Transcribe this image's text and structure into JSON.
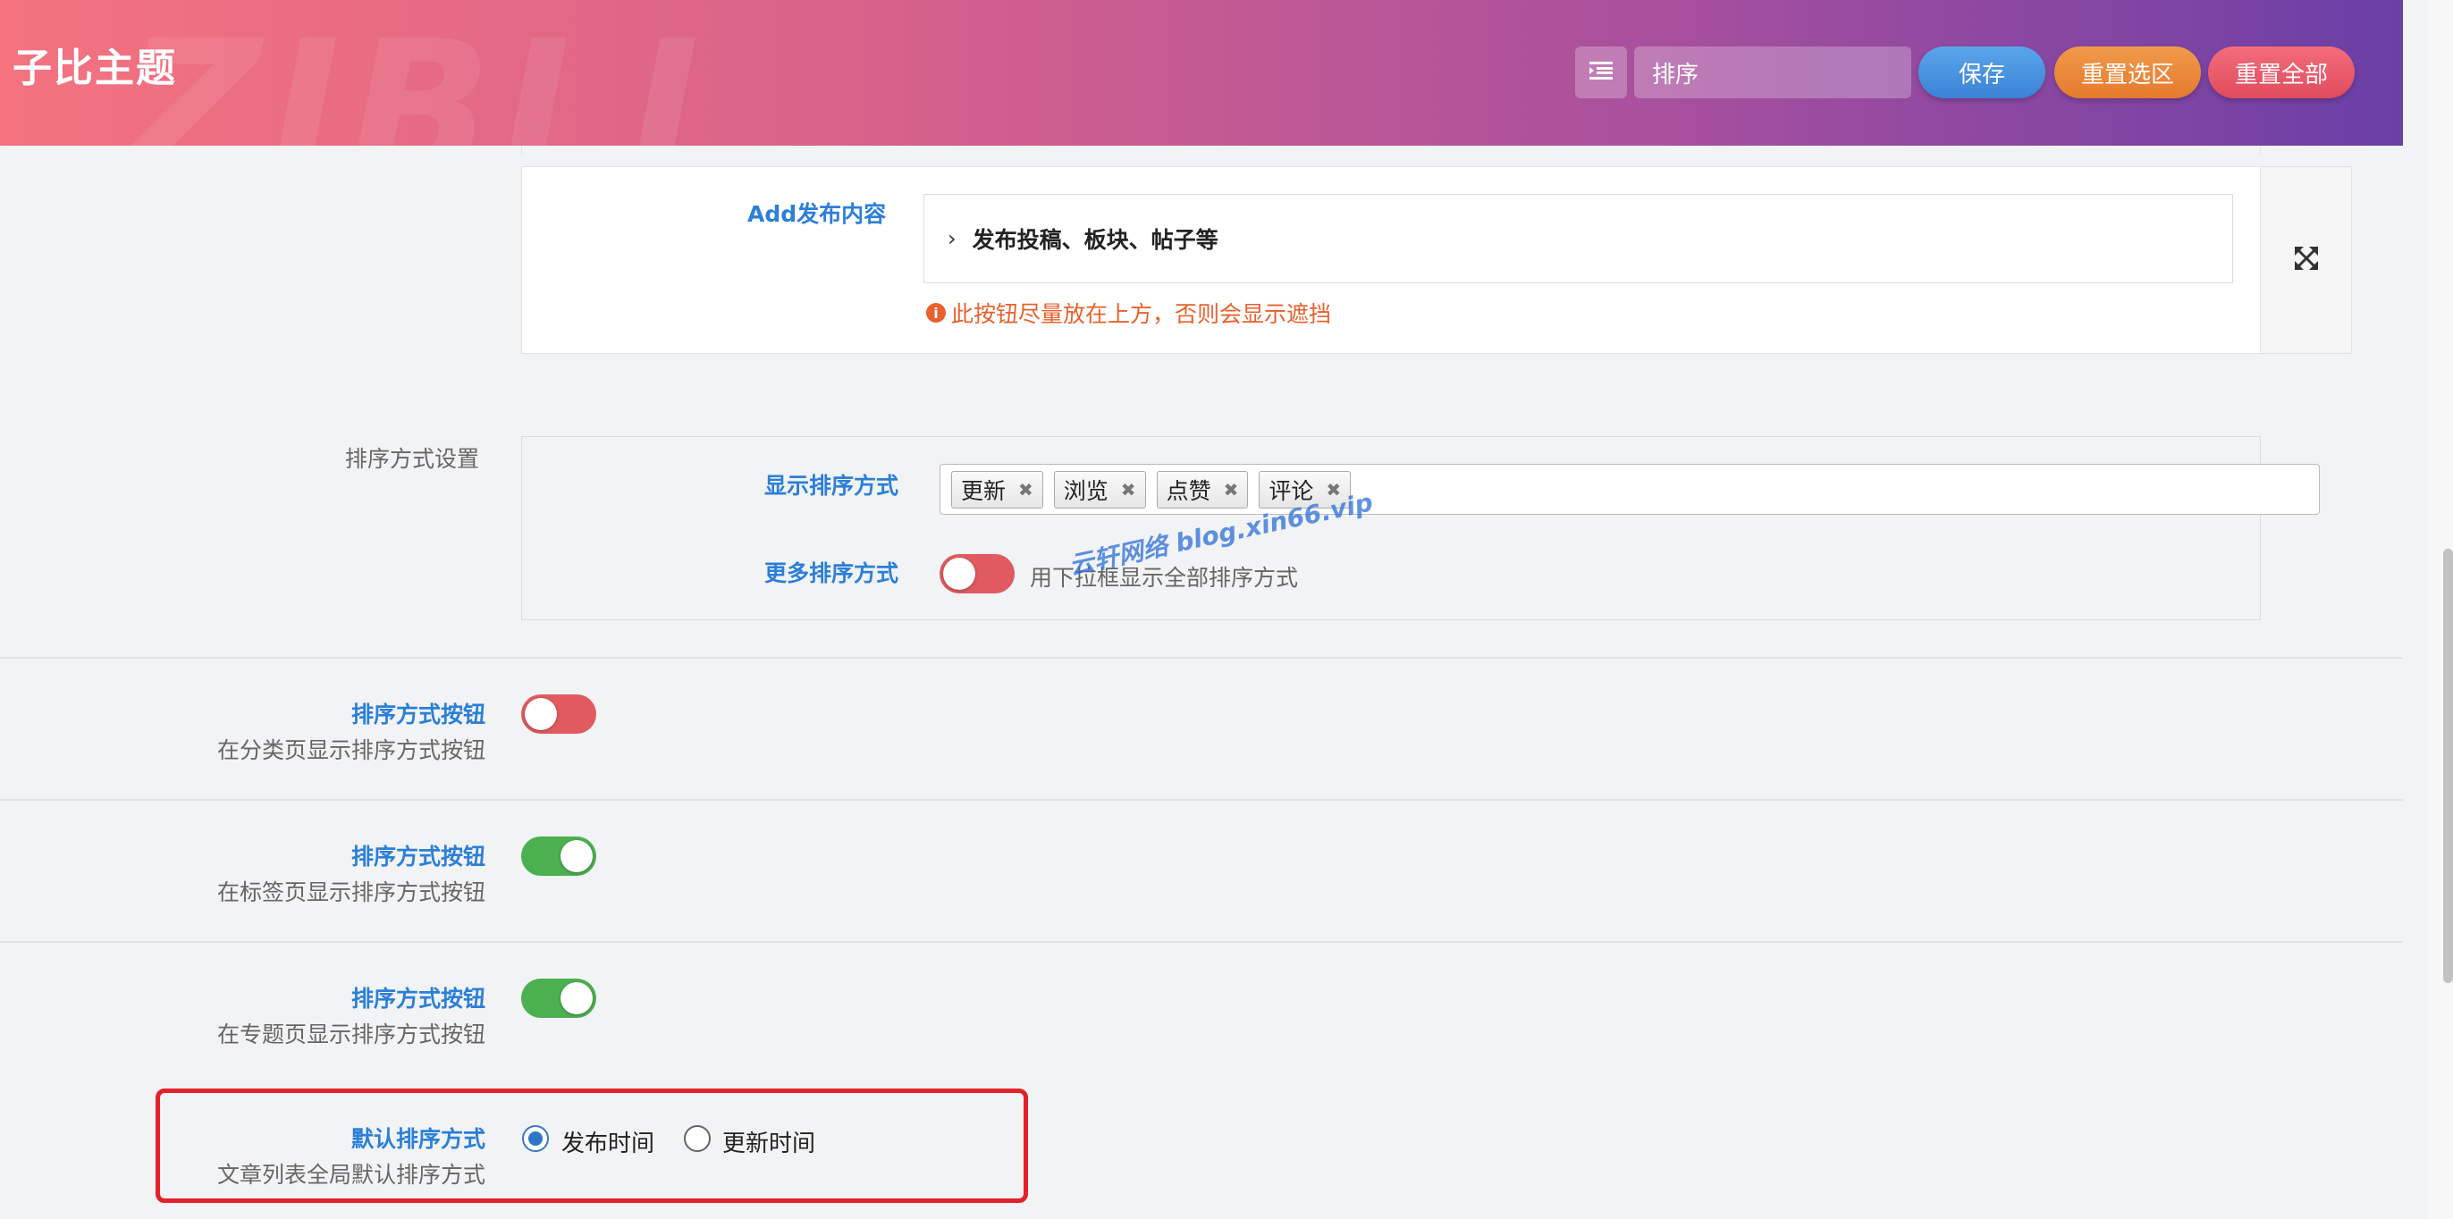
{
  "header": {
    "brand": "子比主题",
    "watermark": "ZIBLL",
    "search_value": "排序",
    "save_label": "保存",
    "reset_section_label": "重置选区",
    "reset_all_label": "重置全部"
  },
  "add_content": {
    "label": "Add发布内容",
    "accordion_text": "发布投稿、板块、帖子等",
    "warning": "此按钮尽量放在上方，否则会显示遮挡"
  },
  "sort_settings": {
    "section_title": "排序方式设置",
    "show_label": "显示排序方式",
    "tags": [
      "更新",
      "浏览",
      "点赞",
      "评论"
    ],
    "more_label": "更多排序方式",
    "more_enabled": false,
    "more_desc": "用下拉框显示全部排序方式",
    "watermark": "云轩网络 blog.xin66.vip"
  },
  "rows": [
    {
      "title": "排序方式按钮",
      "desc": "在分类页显示排序方式按钮",
      "enabled": false
    },
    {
      "title": "排序方式按钮",
      "desc": "在标签页显示排序方式按钮",
      "enabled": true
    },
    {
      "title": "排序方式按钮",
      "desc": "在专题页显示排序方式按钮",
      "enabled": true
    }
  ],
  "default_sort": {
    "title": "默认排序方式",
    "desc": "文章列表全局默认排序方式",
    "options": [
      "发布时间",
      "更新时间"
    ],
    "selected": "发布时间"
  },
  "colors": {
    "accent_blue": "#2b7fd8",
    "toggle_on": "#4caf50",
    "toggle_off": "#e05a5f",
    "warning": "#e8612c",
    "highlight_border": "#e5202b"
  },
  "icons": {
    "menu": "menu-icon",
    "expand": "expand-arrows-icon",
    "info": "info-circle-icon",
    "chevron": "chevron-right-icon",
    "remove": "close-icon"
  }
}
